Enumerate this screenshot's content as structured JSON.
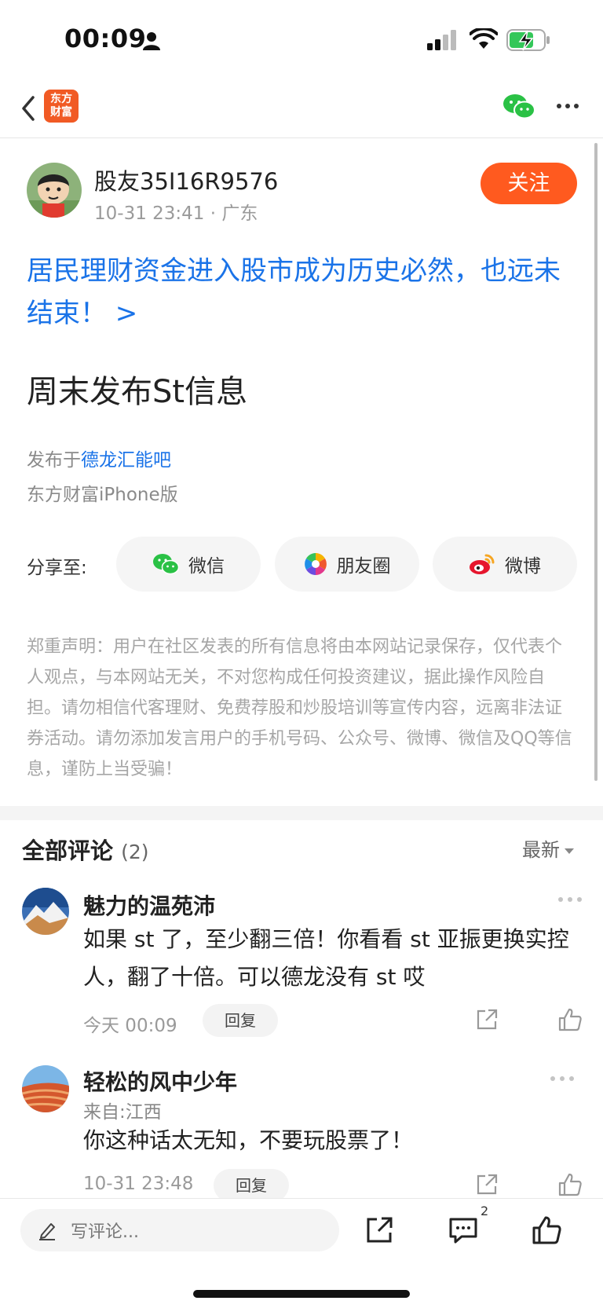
{
  "status_bar": {
    "time": "00:09"
  },
  "nav": {
    "logo_line1": "东方",
    "logo_line2": "财富"
  },
  "post": {
    "author": "股友35I16R9576",
    "meta": "10-31 23:41  · 广东",
    "follow_label": "关注",
    "headline": "居民理财资金进入股市成为历史必然，也远未结束！ >",
    "body": "周末发布St信息",
    "published_prefix": "发布于",
    "published_forum": "德龙汇能吧",
    "device": "东方财富iPhone版"
  },
  "share": {
    "label": "分享至:",
    "items": [
      {
        "label": "微信",
        "icon": "wechat-icon"
      },
      {
        "label": "朋友圈",
        "icon": "moments-icon"
      },
      {
        "label": "微博",
        "icon": "weibo-icon"
      }
    ]
  },
  "disclaimer": "郑重声明：用户在社区发表的所有信息将由本网站记录保存，仅代表个人观点，与本网站无关，不对您构成任何投资建议，据此操作风险自担。请勿相信代客理财、免费荐股和炒股培训等宣传内容，远离非法证券活动。请勿添加发言用户的手机号码、公众号、微博、微信及QQ等信息，谨防上当受骗！",
  "comments": {
    "title": "全部评论",
    "count": "(2)",
    "sort": "最新",
    "items": [
      {
        "name": "魅力的温苑沛",
        "text": "如果 st 了，至少翻三倍！你看看 st 亚振更换实控人，翻了十倍。可以德龙没有 st 哎",
        "time": "今天 00:09",
        "reply": "回复"
      },
      {
        "name": "轻松的风中少年",
        "location": "来自:江西",
        "text": "你这种话太无知，不要玩股票了！",
        "time": "10-31 23:48",
        "reply": "回复"
      }
    ]
  },
  "bottom_bar": {
    "placeholder": "写评论...",
    "comment_badge": "2"
  },
  "colors": {
    "accent_orange": "#ff5a1f",
    "link_blue": "#1a73e8",
    "wechat_green": "#2ac145"
  }
}
